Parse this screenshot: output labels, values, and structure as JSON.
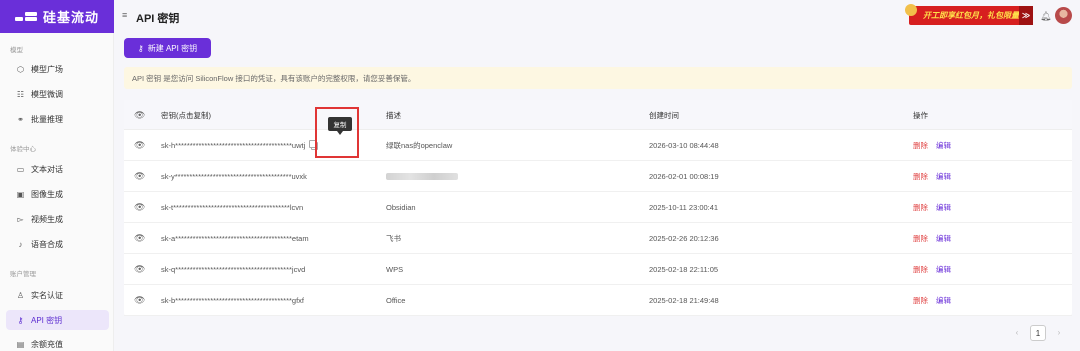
{
  "brand": {
    "name": "硅基流动"
  },
  "header": {
    "title": "API 密钥",
    "promo": "开工即享红包月，礼包限量",
    "promo_arrow": "≫"
  },
  "sidebar": {
    "sections": [
      {
        "label": "模型"
      },
      {
        "label": "体验中心"
      },
      {
        "label": "账户管理"
      }
    ],
    "items": [
      {
        "label": "模型广场",
        "icon": "cube-icon"
      },
      {
        "label": "模型微调",
        "icon": "tune-icon"
      },
      {
        "label": "批量推理",
        "icon": "link-icon"
      },
      {
        "label": "文本对话",
        "icon": "chat-icon"
      },
      {
        "label": "图像生成",
        "icon": "image-icon"
      },
      {
        "label": "视频生成",
        "icon": "video-icon"
      },
      {
        "label": "语音合成",
        "icon": "mic-icon"
      },
      {
        "label": "实名认证",
        "icon": "user-check-icon"
      },
      {
        "label": "API 密钥",
        "icon": "key-icon",
        "active": true
      },
      {
        "label": "余额充值",
        "icon": "wallet-icon"
      }
    ]
  },
  "toolbar": {
    "new_key_label": "新建 API 密钥"
  },
  "notice": {
    "text": "API 密钥 是您访问 SiliconFlow 接口的凭证，具有该账户的完整权限，请您妥善保管。"
  },
  "table": {
    "columns": {
      "key": "密钥(点击复制)",
      "desc": "描述",
      "created": "创建时间",
      "actions": "操作"
    },
    "rows": [
      {
        "key": "sk-h****************************************uwtj",
        "desc": "绿联nas的openclaw",
        "created": "2026-03-10 08:44:48"
      },
      {
        "key": "sk-y****************************************uvxk",
        "desc": "",
        "created": "2026-02-01 00:08:19"
      },
      {
        "key": "sk-t****************************************lcvn",
        "desc": "Obsidian",
        "created": "2025-10-11 23:00:41"
      },
      {
        "key": "sk-a****************************************etam",
        "desc": "飞书",
        "created": "2025-02-26 20:12:36"
      },
      {
        "key": "sk-q****************************************jcvd",
        "desc": "WPS",
        "created": "2025-02-18 22:11:05"
      },
      {
        "key": "sk-b****************************************gfxf",
        "desc": "Office",
        "created": "2025-02-18 21:49:48"
      }
    ],
    "delete_label": "删除",
    "edit_label": "编辑"
  },
  "tooltip": {
    "text": "复制"
  },
  "pagination": {
    "current": "1",
    "prev": "‹",
    "next": "›"
  },
  "colors": {
    "brand": "#6a2fd9",
    "danger": "#e04444",
    "highlight": "#e03535"
  }
}
